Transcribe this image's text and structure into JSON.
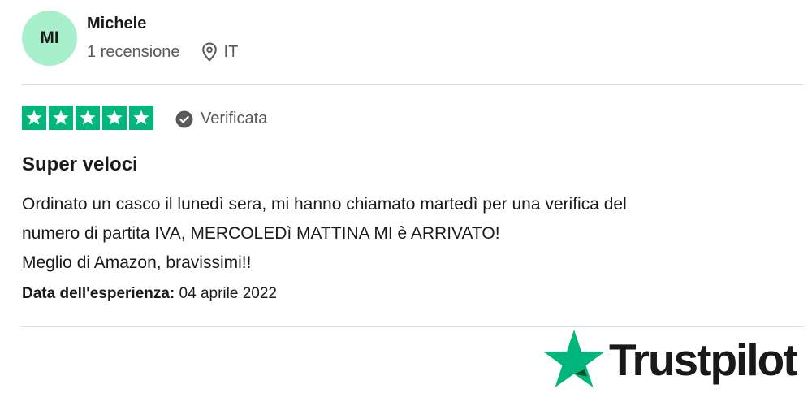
{
  "reviewer": {
    "initials": "MI",
    "name": "Michele",
    "review_count": "1 recensione",
    "country": "IT"
  },
  "rating": {
    "stars": 5,
    "verified_label": "Verificata"
  },
  "review": {
    "title": "Super veloci",
    "body_lines": [
      "Ordinato un casco il lunedì sera, mi hanno chiamato martedì per una verifica del",
      "numero di partita IVA, MERCOLEDì MATTINA MI è ARRIVATO!",
      "Meglio di Amazon, bravissimi!!"
    ],
    "experience_label": "Data dell'esperienza:",
    "experience_date": "04 aprile 2022"
  },
  "brand": {
    "name": "Trustpilot",
    "star_color": "#00b67a"
  },
  "colors": {
    "avatar_bg": "#a8f0cc",
    "star_bg": "#00b67a",
    "muted_text": "#595959"
  },
  "icons": [
    "location-pin-icon",
    "verified-check-icon",
    "star-icon",
    "trustpilot-star-icon"
  ]
}
